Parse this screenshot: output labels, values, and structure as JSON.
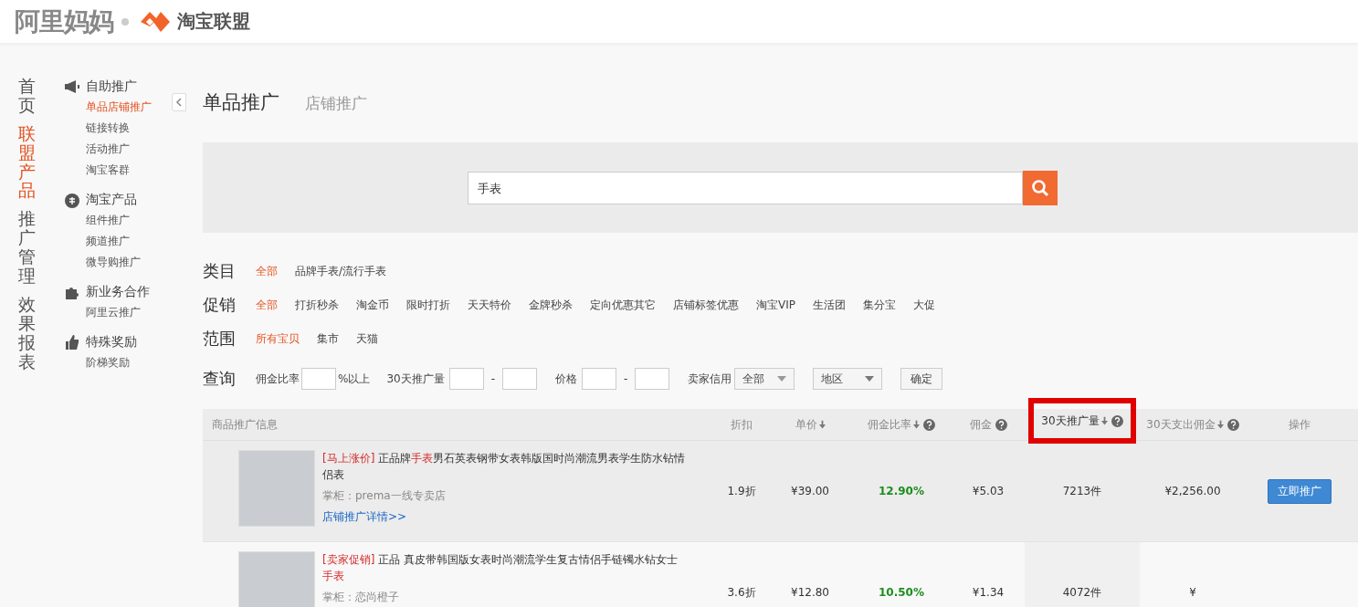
{
  "header": {
    "brand": "阿里妈妈",
    "product": "淘宝联盟"
  },
  "main_nav": [
    {
      "label": "首页",
      "selected": false
    },
    {
      "label": "联盟产品",
      "selected": true
    },
    {
      "label": "推广管理",
      "selected": false
    },
    {
      "label": "效果报表",
      "selected": false
    }
  ],
  "sub_nav": [
    {
      "label": "自助推广",
      "kind": "megaphone",
      "items": [
        {
          "label": "单品店铺推广",
          "selected": true
        },
        {
          "label": "链接转换",
          "selected": false
        },
        {
          "label": "活动推广",
          "selected": false
        },
        {
          "label": "淘宝客群",
          "selected": false
        }
      ]
    },
    {
      "label": "淘宝产品",
      "kind": "tao",
      "items": [
        {
          "label": "组件推广",
          "selected": false
        },
        {
          "label": "频道推广",
          "selected": false
        },
        {
          "label": "微导购推广",
          "selected": false
        }
      ]
    },
    {
      "label": "新业务合作",
      "kind": "puzzle",
      "items": [
        {
          "label": "阿里云推广",
          "selected": false
        }
      ]
    },
    {
      "label": "特殊奖励",
      "kind": "thumb",
      "items": [
        {
          "label": "阶梯奖励",
          "selected": false
        }
      ]
    }
  ],
  "tabs": [
    {
      "label": "单品推广",
      "selected": true
    },
    {
      "label": "店铺推广",
      "selected": false
    }
  ],
  "search": {
    "value": "手表"
  },
  "filters": [
    {
      "label": "类目",
      "options": [
        {
          "label": "全部",
          "selected": true
        },
        {
          "label": "品牌手表/流行手表",
          "selected": false
        }
      ]
    },
    {
      "label": "促销",
      "options": [
        {
          "label": "全部",
          "selected": true
        },
        {
          "label": "打折秒杀",
          "selected": false
        },
        {
          "label": "淘金币",
          "selected": false
        },
        {
          "label": "限时打折",
          "selected": false
        },
        {
          "label": "天天特价",
          "selected": false
        },
        {
          "label": "金牌秒杀",
          "selected": false
        },
        {
          "label": "定向优惠其它",
          "selected": false
        },
        {
          "label": "店铺标签优惠",
          "selected": false
        },
        {
          "label": "淘宝VIP",
          "selected": false
        },
        {
          "label": "生活团",
          "selected": false
        },
        {
          "label": "集分宝",
          "selected": false
        },
        {
          "label": "大促",
          "selected": false
        }
      ]
    },
    {
      "label": "范围",
      "options": [
        {
          "label": "所有宝贝",
          "selected": true
        },
        {
          "label": "集市",
          "selected": false
        },
        {
          "label": "天猫",
          "selected": false
        }
      ]
    }
  ],
  "query": {
    "label": "查询",
    "commission_label": "佣金比率",
    "commission_suffix": "%以上",
    "volume_label": "30天推广量",
    "range_sep": "-",
    "price_label": "价格",
    "credit_label": "卖家信用",
    "credit_value": "全部",
    "region_value": "地区",
    "confirm": "确定"
  },
  "table": {
    "columns": [
      {
        "label": "商品推广信息",
        "sort": false,
        "help": false,
        "highlighted": false
      },
      {
        "label": "折扣",
        "sort": false,
        "help": false,
        "highlighted": false
      },
      {
        "label": "单价",
        "sort": true,
        "help": false,
        "highlighted": false
      },
      {
        "label": "佣金比率",
        "sort": true,
        "help": true,
        "highlighted": false
      },
      {
        "label": "佣金",
        "sort": false,
        "help": true,
        "highlighted": false
      },
      {
        "label": "30天推广量",
        "sort": true,
        "help": true,
        "highlighted": true
      },
      {
        "label": "30天支出佣金",
        "sort": true,
        "help": true,
        "highlighted": false
      },
      {
        "label": "操作",
        "sort": false,
        "help": false,
        "highlighted": false
      }
    ],
    "rows": [
      {
        "hovered": true,
        "tag": "[马上涨价]",
        "title": [
          {
            "text": "正品牌",
            "hit": false
          },
          {
            "text": "手表",
            "hit": true
          },
          {
            "text": "男石英表钢带女表韩版国时尚潮流男表学生防水钻情侣表",
            "hit": false
          }
        ],
        "shop": "掌柜：prema一线专卖店",
        "link": "店铺推广详情>>",
        "discount": "1.9折",
        "price": "¥39.00",
        "rate": "12.90%",
        "commission": "¥5.03",
        "volume": "7213件",
        "spent": "¥2,256.00",
        "action": "立即推广"
      },
      {
        "hovered": false,
        "tag": "[卖家促销]",
        "title": [
          {
            "text": "正品 真皮带韩国版女表时尚潮流学生复古情侣手链镯水钻女士",
            "hit": false
          },
          {
            "text": "手表",
            "hit": true
          }
        ],
        "shop": "掌柜：恋尚橙子",
        "discount": "3.6折",
        "price": "¥12.80",
        "rate": "10.50%",
        "commission": "¥1.34",
        "volume": "4072件",
        "spent": "¥"
      }
    ]
  }
}
